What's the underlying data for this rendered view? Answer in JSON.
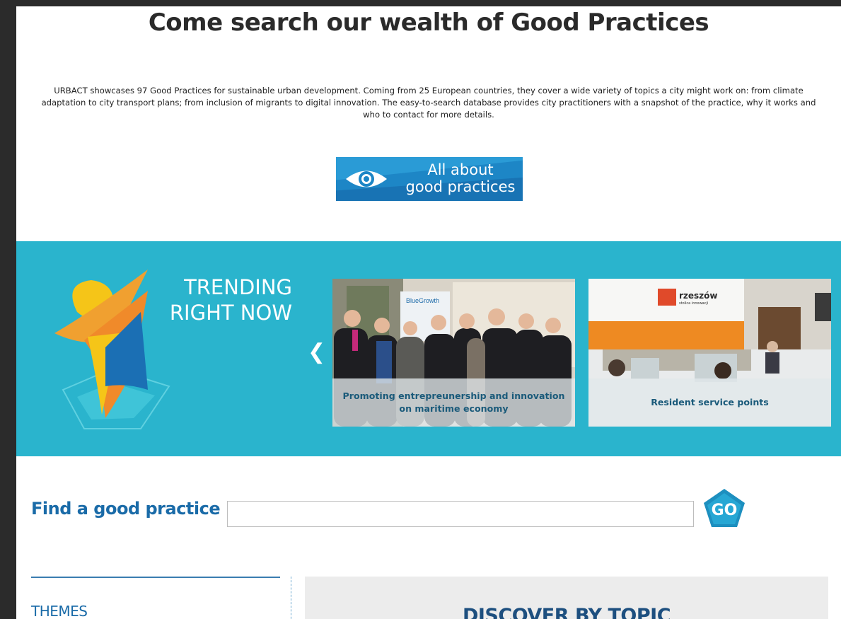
{
  "headline": "Come search our wealth of Good Practices",
  "intro": "URBACT showcases 97 Good Practices for sustainable urban development. Coming from 25 European countries, they cover a wide variety of topics a city might work on: from climate adaptation to city transport plans; from inclusion of migrants to digital innovation. The easy-to-search database provides city practitioners with a snapshot of the practice, why it works and who to contact for more details.",
  "about_button": {
    "line1": "All about",
    "line2": "good practices",
    "icon": "eye-icon"
  },
  "trending": {
    "title_line1": "TRENDING",
    "title_line2": "RIGHT NOW",
    "prev_icon": "chevron-left-icon",
    "cards": [
      {
        "caption": "Promoting entrepreunership and innovation on maritime economy",
        "sign": "BlueGrowth"
      },
      {
        "caption": "Resident service points",
        "sign": "rzeszów",
        "sign_sub": "stolica innowacji"
      }
    ]
  },
  "search": {
    "label": "Find a good practice",
    "placeholder": "",
    "value": "",
    "go_label": "GO"
  },
  "themes": {
    "label": "THEMES"
  },
  "discover": {
    "title": "DISCOVER BY TOPIC"
  },
  "colors": {
    "accent": "#2ab4cd",
    "brand_blue": "#1a6ba8",
    "dark_blue": "#1d4f7f"
  }
}
